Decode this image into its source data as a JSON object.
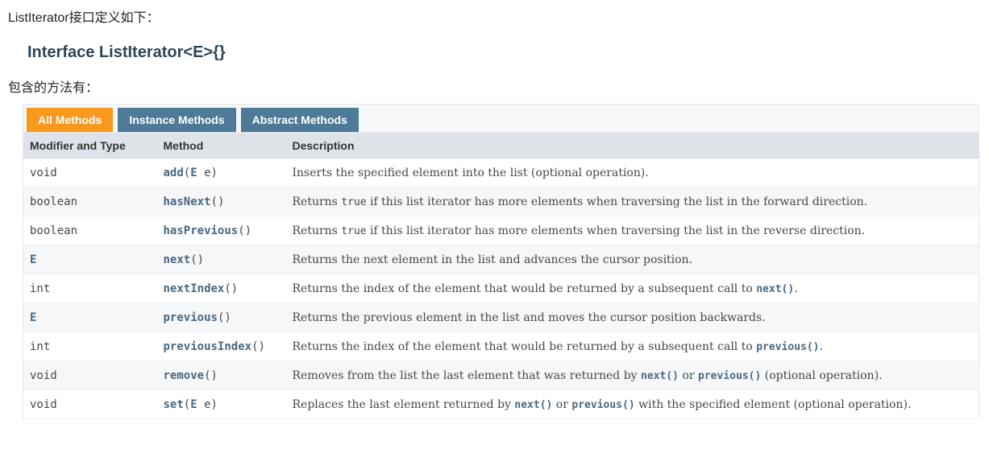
{
  "intro": "ListIterator接口定义如下：",
  "heading": "Interface ListIterator<E>{}",
  "methods_label": "包含的方法有：",
  "tabs": {
    "all": "All Methods",
    "instance": "Instance Methods",
    "abstract": "Abstract Methods"
  },
  "headers": {
    "modifier": "Modifier and Type",
    "method": "Method",
    "description": "Description"
  },
  "rows": [
    {
      "type_html": "void",
      "method_html": "<span class='method-name'>add</span>​(<span class='type-link'>E</span> e)",
      "desc_html": "Inserts the specified element into the list (optional operation)."
    },
    {
      "type_html": "boolean",
      "method_html": "<span class='method-name'>hasNext</span>()",
      "desc_html": "Returns <span class='desc-code'>true</span> if this list iterator has more elements when traversing the list in the forward direction."
    },
    {
      "type_html": "boolean",
      "method_html": "<span class='method-name'>hasPrevious</span>()",
      "desc_html": "Returns <span class='desc-code'>true</span> if this list iterator has more elements when traversing the list in the reverse direction."
    },
    {
      "type_html": "<span class='type-link'>E</span>",
      "method_html": "<span class='method-name'>next</span>()",
      "desc_html": "Returns the next element in the list and advances the cursor position."
    },
    {
      "type_html": "int",
      "method_html": "<span class='method-name'>nextIndex</span>()",
      "desc_html": "Returns the index of the element that would be returned by a subsequent call to <span class='link-code'>next()</span>."
    },
    {
      "type_html": "<span class='type-link'>E</span>",
      "method_html": "<span class='method-name'>previous</span>()",
      "desc_html": "Returns the previous element in the list and moves the cursor position backwards."
    },
    {
      "type_html": "int",
      "method_html": "<span class='method-name'>previousIndex</span>()",
      "desc_html": "Returns the index of the element that would be returned by a subsequent call to <span class='link-code'>previous()</span>."
    },
    {
      "type_html": "void",
      "method_html": "<span class='method-name'>remove</span>()",
      "desc_html": "Removes from the list the last element that was returned by <span class='link-code'>next()</span> or <span class='link-code'>previous()</span> (optional operation)."
    },
    {
      "type_html": "void",
      "method_html": "<span class='method-name'>set</span>​(<span class='type-link'>E</span> e)",
      "desc_html": "Replaces the last element returned by <span class='link-code'>next()</span> or <span class='link-code'>previous()</span> with the specified element (optional operation)."
    }
  ]
}
